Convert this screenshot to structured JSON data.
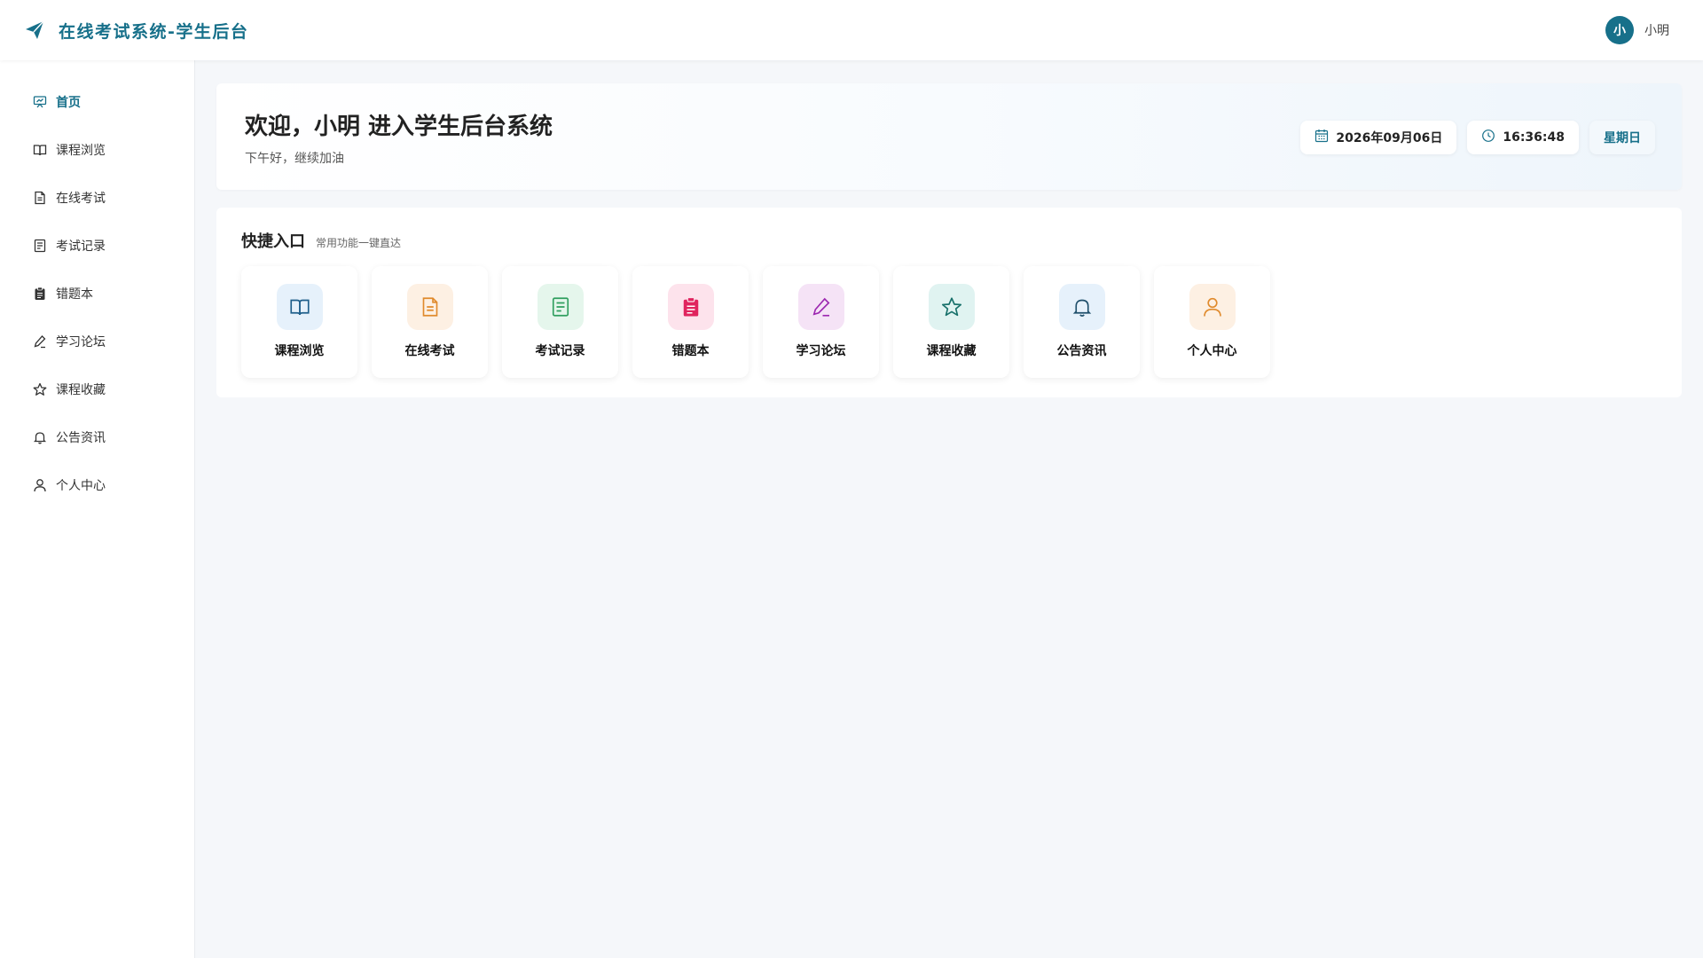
{
  "header": {
    "title": "在线考试系统-学生后台",
    "brand_icon": "paper-plane-icon",
    "avatar_letter": "小",
    "user_name": "小明"
  },
  "colors": {
    "accent": "#17708a",
    "background": "#f5f7fa"
  },
  "sidebar": {
    "items": [
      {
        "label": "首页",
        "icon": "presentation-icon",
        "active": true
      },
      {
        "label": "课程浏览",
        "icon": "book-icon",
        "active": false
      },
      {
        "label": "在线考试",
        "icon": "document-icon",
        "active": false
      },
      {
        "label": "考试记录",
        "icon": "record-icon",
        "active": false
      },
      {
        "label": "错题本",
        "icon": "clipboard-icon",
        "active": false
      },
      {
        "label": "学习论坛",
        "icon": "pen-icon",
        "active": false
      },
      {
        "label": "课程收藏",
        "icon": "star-icon",
        "active": false
      },
      {
        "label": "公告资讯",
        "icon": "bell-icon",
        "active": false
      },
      {
        "label": "个人中心",
        "icon": "user-icon",
        "active": false
      }
    ]
  },
  "welcome": {
    "title": "欢迎，小明 进入学生后台系统",
    "subtitle": "下午好，继续加油",
    "date": "2026年09月06日",
    "time": "16:36:48",
    "weekday": "星期日"
  },
  "quick": {
    "title": "快捷入口",
    "subtitle": "常用功能一键直达",
    "cards": [
      {
        "label": "课程浏览",
        "icon": "book-icon",
        "bg": "#e6f1fb",
        "fg": "#1f5f8b"
      },
      {
        "label": "在线考试",
        "icon": "document-icon",
        "bg": "#fdf0e3",
        "fg": "#e08a2c"
      },
      {
        "label": "考试记录",
        "icon": "record-icon",
        "bg": "#e5f6ec",
        "fg": "#2f9e5e"
      },
      {
        "label": "错题本",
        "icon": "clipboard-icon",
        "bg": "#fde3ec",
        "fg": "#e0245e"
      },
      {
        "label": "学习论坛",
        "icon": "pen-icon",
        "bg": "#f5e3f6",
        "fg": "#9c27b0"
      },
      {
        "label": "课程收藏",
        "icon": "star-icon",
        "bg": "#e0f3f1",
        "fg": "#17706a"
      },
      {
        "label": "公告资讯",
        "icon": "bell-icon",
        "bg": "#e6f1fb",
        "fg": "#1f4f6b"
      },
      {
        "label": "个人中心",
        "icon": "user-icon",
        "bg": "#fdf0e3",
        "fg": "#e08a2c"
      }
    ]
  }
}
